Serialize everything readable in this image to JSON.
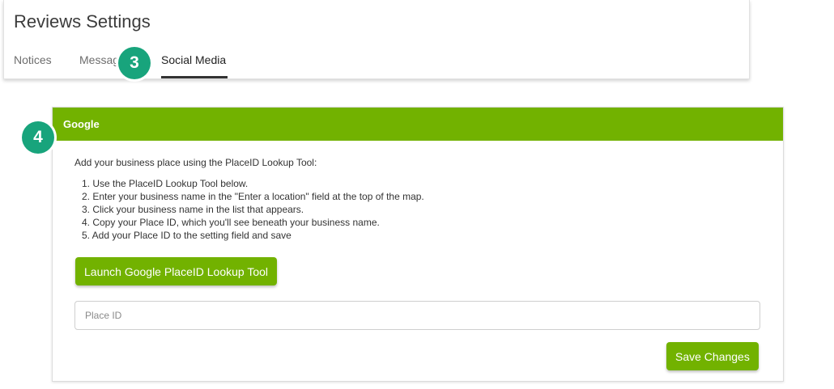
{
  "header": {
    "title": "Reviews Settings",
    "tabs": [
      {
        "label": "Notices"
      },
      {
        "label": "Messag"
      },
      {
        "label": "Social Media"
      }
    ]
  },
  "annotations": {
    "badge_3": "3",
    "badge_4": "4",
    "badge_color": "#18a47c"
  },
  "panel": {
    "title": "Google",
    "accent_color": "#72b200",
    "intro": "Add your business place using the PlaceID Lookup Tool:",
    "steps": [
      "1. Use the PlaceID Lookup Tool below.",
      "2. Enter your business name in the \"Enter a location\" field at the top of the map.",
      "3. Click your business name in the list that appears.",
      "4. Copy your Place ID, which you'll see beneath your business name.",
      "5. Add your Place ID to the setting field and save"
    ],
    "launch_button": "Launch Google PlaceID Lookup Tool",
    "place_id_placeholder": "Place ID",
    "place_id_value": "",
    "save_button": "Save Changes"
  }
}
